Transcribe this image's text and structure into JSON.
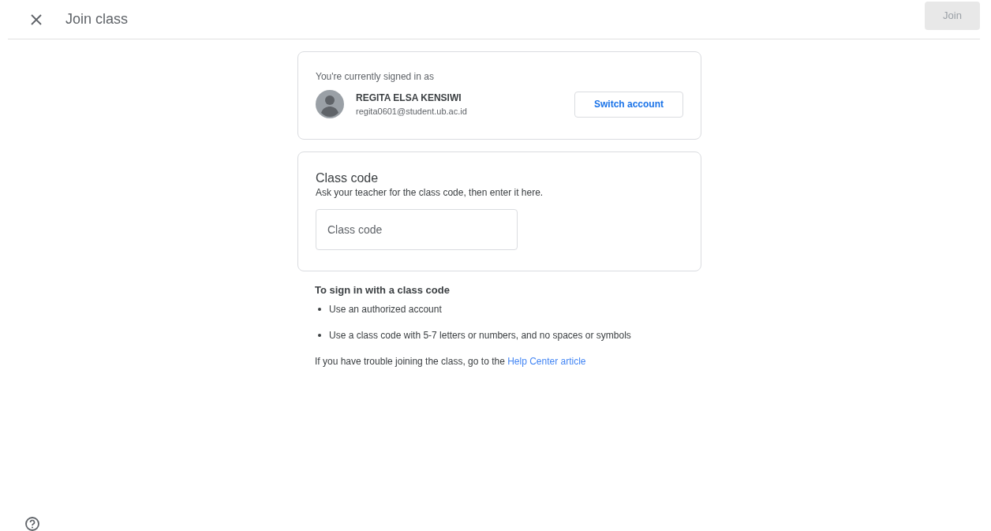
{
  "header": {
    "title": "Join class",
    "join_button": {
      "label": "Join",
      "disabled": true
    }
  },
  "account": {
    "caption": "You're currently signed in as",
    "name": "REGITA ELSA KENSIWI",
    "email": "regita0601@student.ub.ac.id",
    "switch_button": "Switch account"
  },
  "class_code": {
    "title": "Class code",
    "hint": "Ask your teacher for the class code, then enter it here.",
    "field": {
      "placeholder": "Class code"
    }
  },
  "instructions": {
    "title": "To sign in with a class code",
    "items": [
      "Use an authorized account",
      "Use a class code with 5-7 letters or numbers, and no spaces or symbols"
    ],
    "help_text": "If you have trouble joining the class, go to the",
    "help_link": "Help Center article"
  }
}
